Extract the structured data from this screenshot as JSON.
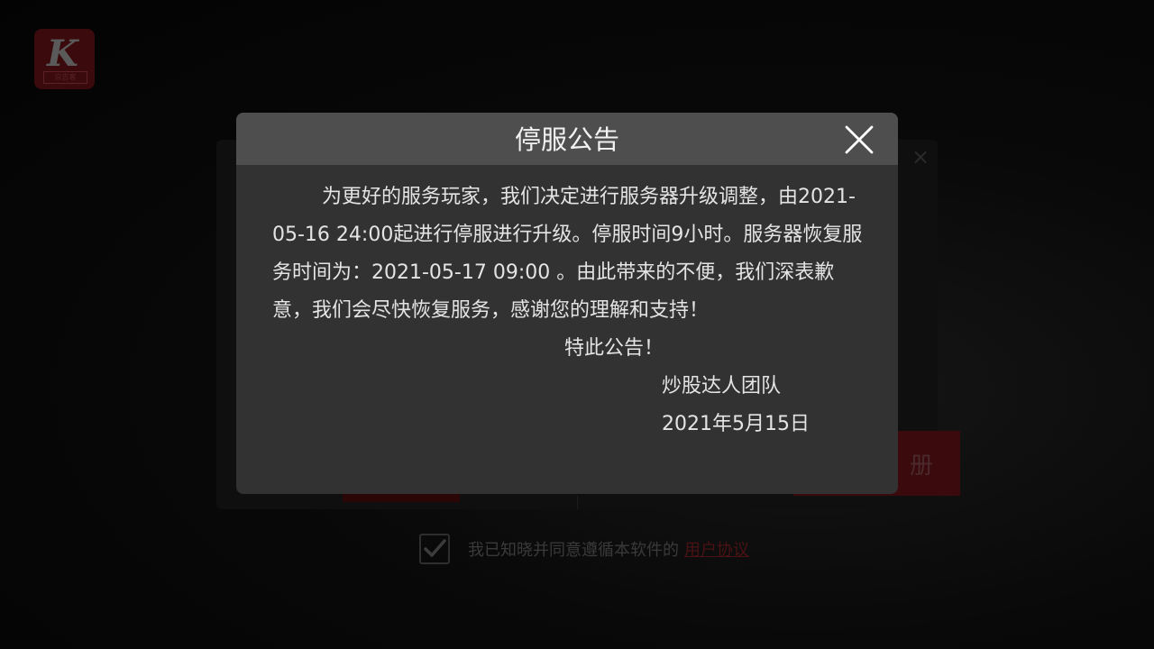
{
  "background": {
    "logo": {
      "mark": "K",
      "subtitle": "白吉客"
    },
    "register_button_label": "册",
    "agreement": {
      "checked": true,
      "text": "我已知晓并同意遵循本软件的",
      "link": "用户协议"
    }
  },
  "dialog": {
    "title": "停服公告",
    "body": "为更好的服务玩家，我们决定进行服务器升级调整，由2021-05-16 24:00起进行停服进行升级。停服时间9小时。服务器恢复服务时间为：2021-05-17  09:00 。由此带来的不便，我们深表歉意，我们会尽快恢复服务，感谢您的理解和支持！",
    "notice_end": "特此公告！",
    "signature": "炒股达人团队",
    "date": "2021年5月15日"
  },
  "colors": {
    "overlay": "#000000",
    "dialog_bg": "#323232",
    "dialog_header": "#4e4e4e",
    "text": "#e4e4e4",
    "accent_red": "#3a0a0c"
  },
  "icons": {
    "close": "close-icon",
    "check": "checkmark-icon"
  }
}
